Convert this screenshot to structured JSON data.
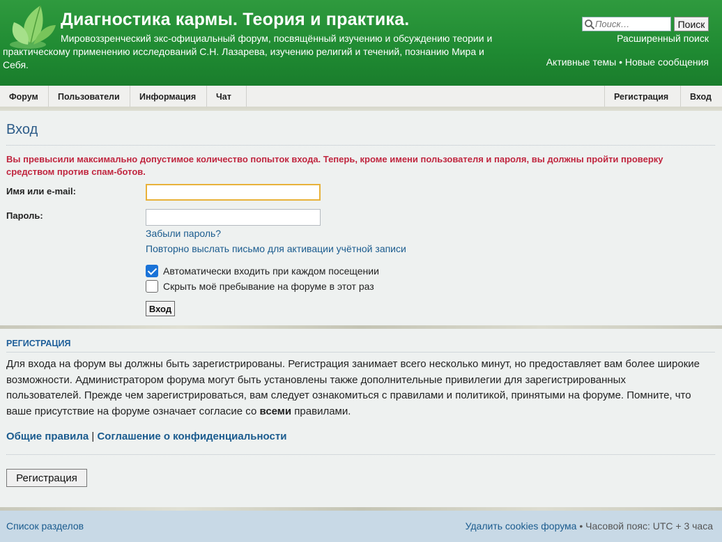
{
  "header": {
    "title": "Диагностика кармы. Теория и практика.",
    "description": "Мировоззренческий экс-официальный форум, посвящённый изучению и обсуждению теории и практическому применению исследований С.Н. Лазарева, изучению религий и течений, познанию Мира и Себя.",
    "search_placeholder": "Поиск…",
    "search_button": "Поиск",
    "advanced_search": "Расширенный поиск",
    "active_topics": "Активные темы",
    "bullet": "•",
    "new_posts": "Новые сообщения"
  },
  "nav": {
    "forum": "Форум",
    "users": "Пользователи",
    "info": "Информация",
    "chat": "Чат",
    "register": "Регистрация",
    "login": "Вход"
  },
  "login": {
    "title": "Вход",
    "error": "Вы превысили максимально допустимое количество попыток входа. Теперь, кроме имени пользователя и пароля, вы должны пройти проверку средством против спам-ботов.",
    "username_label": "Имя или e-mail:",
    "username_value": "",
    "password_label": "Пароль:",
    "password_value": "",
    "forgot_password": "Забыли пароль?",
    "resend_activation": "Повторно выслать письмо для активации учётной записи",
    "autologin_label": "Автоматически входить при каждом посещении",
    "autologin_checked": true,
    "hide_label": "Скрыть моё пребывание на форуме в этот раз",
    "hide_checked": false,
    "submit": "Вход"
  },
  "registration": {
    "heading": "РЕГИСТРАЦИЯ",
    "text_before": "Для входа на форум вы должны быть зарегистрированы. Регистрация занимает всего несколько минут, но предоставляет вам более широкие возможности. Администратором форума могут быть установлены также дополнительные привилегии для зарегистрированных пользователей. Прежде чем зарегистрироваться, вам следует ознакомиться с правилами и политикой, принятыми на форуме. Помните, что ваше присутствие на форуме означает согласие со ",
    "text_bold": "всеми",
    "text_after": " правилами.",
    "rules_link": "Общие правила",
    "divider": "|",
    "privacy_link": "Соглашение о конфиденциальности",
    "button": "Регистрация"
  },
  "footer": {
    "index_link": "Список разделов",
    "delete_cookies": "Удалить cookies форума",
    "bullet": "•",
    "timezone": "Часовой пояс: UTC + 3 часа"
  },
  "colors": {
    "header_green": "#1f8a32",
    "link_blue": "#1a5b8e",
    "error_red": "#c0263f",
    "footer_blue": "#c8d9e6"
  }
}
